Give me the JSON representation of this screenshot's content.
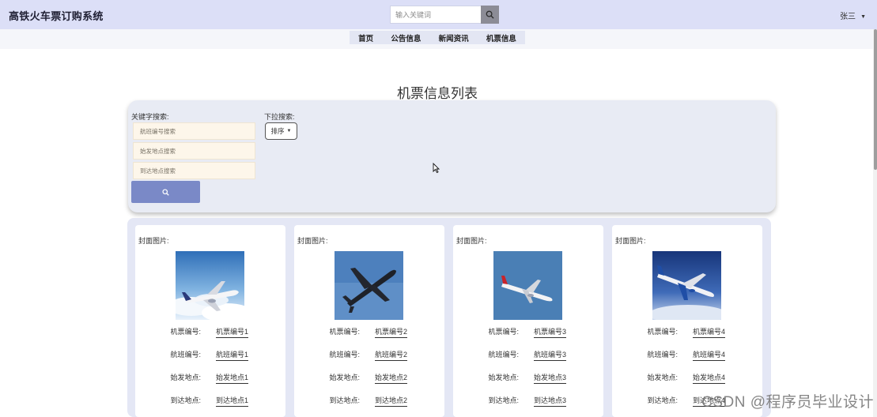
{
  "header": {
    "title": "高铁火车票订购系统",
    "search_placeholder": "输入关键词",
    "user_name": "张三"
  },
  "nav": {
    "items": [
      {
        "label": "首页"
      },
      {
        "label": "公告信息"
      },
      {
        "label": "新闻资讯"
      },
      {
        "label": "机票信息"
      }
    ]
  },
  "page": {
    "title": "机票信息列表"
  },
  "filter": {
    "keyword_label": "关键字搜索:",
    "dropdown_label": "下拉搜索:",
    "flight_no_placeholder": "航班编号搜索",
    "origin_placeholder": "始发地点搜索",
    "destination_placeholder": "到达地点搜索",
    "sort_label": "排序"
  },
  "cards": [
    {
      "cover_label": "封面图片:",
      "ticket_no_key": "机票编号:",
      "ticket_no": "机票编号1",
      "flight_no_key": "航班编号:",
      "flight_no": "航班编号1",
      "origin_key": "始发地点:",
      "origin": "始发地点1",
      "destination_key": "到达地点:",
      "destination": "到达地点1"
    },
    {
      "cover_label": "封面图片:",
      "ticket_no_key": "机票编号:",
      "ticket_no": "机票编号2",
      "flight_no_key": "航班编号:",
      "flight_no": "航班编号2",
      "origin_key": "始发地点:",
      "origin": "始发地点2",
      "destination_key": "到达地点:",
      "destination": "到达地点2"
    },
    {
      "cover_label": "封面图片:",
      "ticket_no_key": "机票编号:",
      "ticket_no": "机票编号3",
      "flight_no_key": "航班编号:",
      "flight_no": "航班编号3",
      "origin_key": "始发地点:",
      "origin": "始发地点3",
      "destination_key": "到达地点:",
      "destination": "到达地点3"
    },
    {
      "cover_label": "封面图片:",
      "ticket_no_key": "机票编号:",
      "ticket_no": "机票编号4",
      "flight_no_key": "航班编号:",
      "flight_no": "航班编号4",
      "origin_key": "始发地点:",
      "origin": "始发地点4",
      "destination_key": "到达地点:",
      "destination": "到达地点4"
    }
  ],
  "icons": {
    "search_button": "search-icon",
    "user_menu": "caret-down-icon",
    "sort_menu": "caret-down-icon"
  },
  "colors": {
    "header_bg": "#dcdff7",
    "search_button_bg": "#7a89c7",
    "panel_bg": "#e8ebf4"
  },
  "watermark": "CSDN @程序员毕业设计"
}
